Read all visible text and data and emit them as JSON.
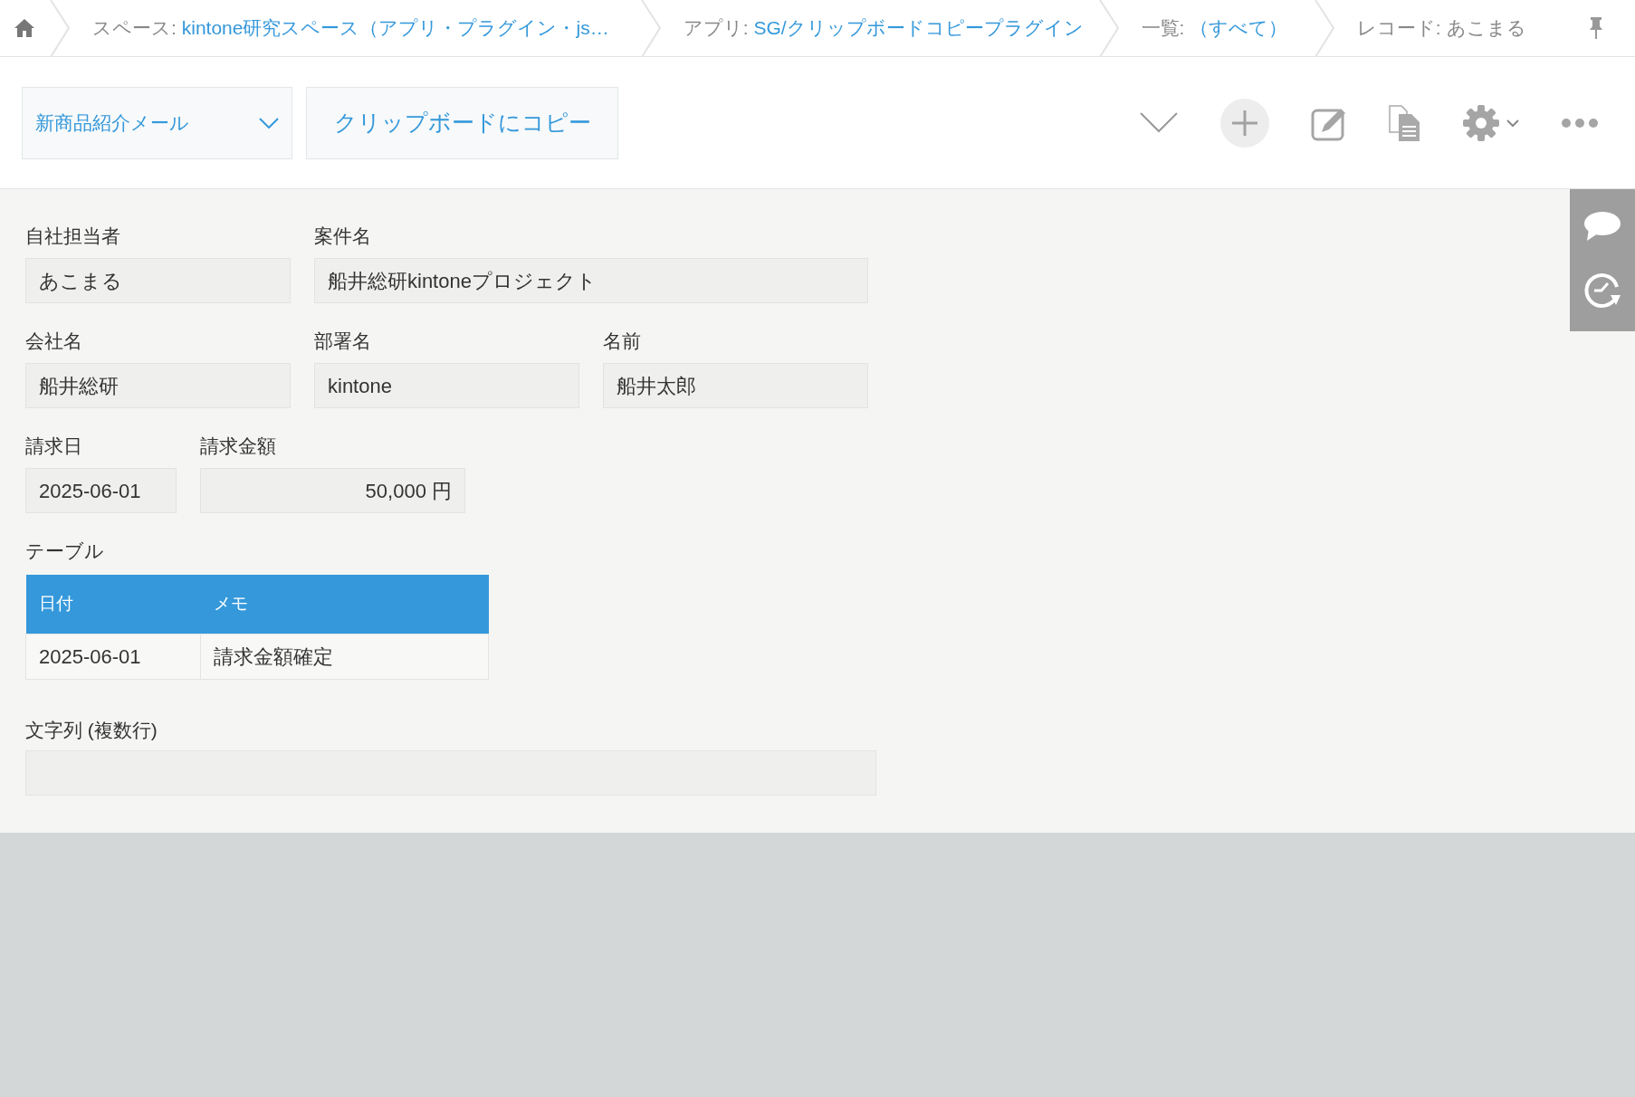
{
  "breadcrumb": [
    {
      "kind": "home"
    },
    {
      "kind": "crumb",
      "prefix": "スペース: ",
      "link": "kintone研究スペース（アプリ・プラグイン・js…"
    },
    {
      "kind": "crumb",
      "prefix": "アプリ: ",
      "link": "SG/クリップボードコピープラグイン"
    },
    {
      "kind": "crumb",
      "prefix": "一覧: ",
      "link": "（すべて）"
    },
    {
      "kind": "crumb",
      "prefix": "レコード: あこまる"
    }
  ],
  "toolbar": {
    "view_select": "新商品紹介メール",
    "copy_button": "クリップボードにコピー"
  },
  "form_rows": [
    [
      {
        "label": "自社担当者",
        "value": "あこまる",
        "kind": "text"
      },
      {
        "label": "案件名",
        "value": "船井総研kintoneプロジェクト",
        "kind": "text"
      }
    ],
    [
      {
        "label": "会社名",
        "value": "船井総研",
        "kind": "text"
      },
      {
        "label": "部署名",
        "value": "kintone",
        "kind": "text"
      },
      {
        "label": "名前",
        "value": "船井太郎",
        "kind": "text"
      }
    ],
    [
      {
        "label": "請求日",
        "value": "2025-06-01",
        "kind": "text"
      },
      {
        "label": "請求金額",
        "value": "50,000 円",
        "kind": "number"
      }
    ]
  ],
  "table": {
    "label": "テーブル",
    "columns": [
      "日付",
      "メモ"
    ],
    "rows": [
      [
        "2025-06-01",
        "請求金額確定"
      ]
    ]
  },
  "multiline": {
    "label": "文字列 (複数行)"
  }
}
